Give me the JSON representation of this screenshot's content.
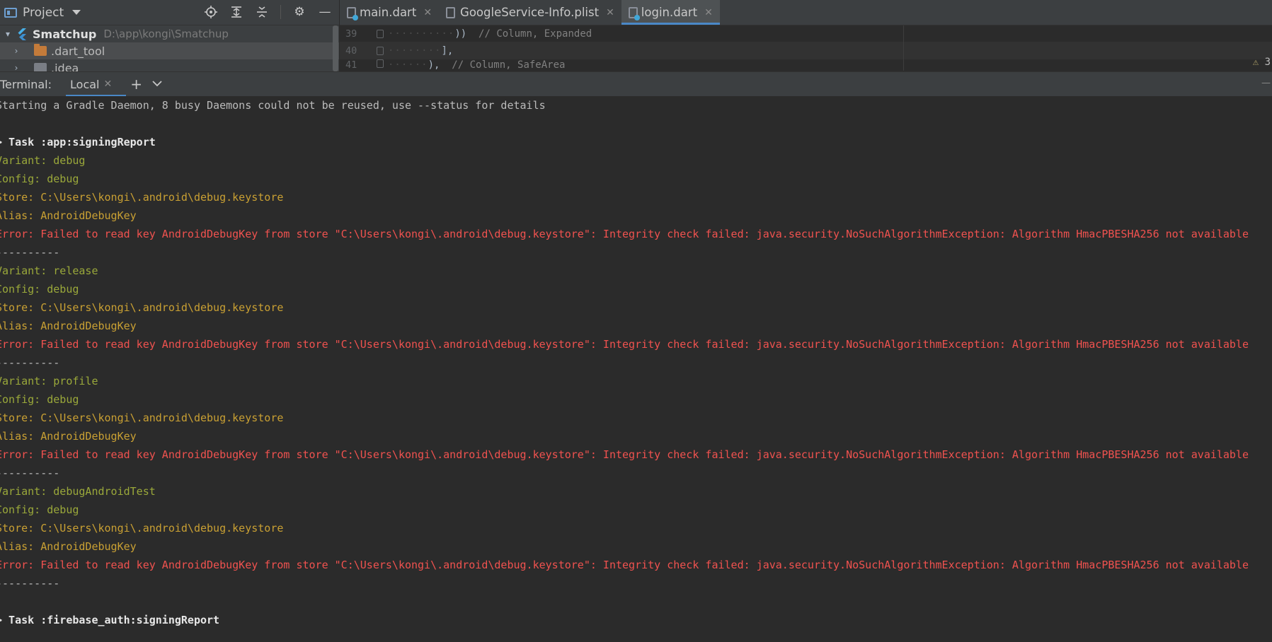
{
  "project_pane": {
    "title": "Project",
    "root": {
      "name": "Smatchup",
      "path": "D:\\app\\kongi\\Smatchup"
    },
    "items": [
      {
        "label": ".dart_tool"
      },
      {
        "label": ".idea"
      }
    ]
  },
  "editor": {
    "tabs": [
      {
        "label": "main.dart"
      },
      {
        "label": "GoogleService-Info.plist"
      },
      {
        "label": "login.dart"
      }
    ],
    "lines": [
      {
        "num": "39",
        "code": "))",
        "comment": "// Column, Expanded"
      },
      {
        "num": "40",
        "code": "],",
        "comment": ""
      },
      {
        "num": "41",
        "code": "),",
        "comment": "// Column, SafeArea"
      }
    ],
    "warnings": "3"
  },
  "terminal": {
    "label": "Terminal:",
    "tab": "Local",
    "lines": [
      {
        "text": "Starting a Gradle Daemon, 8 busy Daemons could not be reused, use --status for details",
        "style": "white"
      },
      {
        "text": "",
        "style": "white"
      },
      {
        "text": "> Task :app:signingReport",
        "style": "bold"
      },
      {
        "text": "Variant: debug",
        "style": "green"
      },
      {
        "text": "Config: debug",
        "style": "green"
      },
      {
        "text": "Store: C:\\Users\\kongi\\.android\\debug.keystore",
        "style": "yellow"
      },
      {
        "text": "Alias: AndroidDebugKey",
        "style": "yellow"
      },
      {
        "text": "Error: Failed to read key AndroidDebugKey from store \"C:\\Users\\kongi\\.android\\debug.keystore\": Integrity check failed: java.security.NoSuchAlgorithmException: Algorithm HmacPBESHA256 not available",
        "style": "red"
      },
      {
        "text": "----------",
        "style": "white"
      },
      {
        "text": "Variant: release",
        "style": "green"
      },
      {
        "text": "Config: debug",
        "style": "green"
      },
      {
        "text": "Store: C:\\Users\\kongi\\.android\\debug.keystore",
        "style": "yellow"
      },
      {
        "text": "Alias: AndroidDebugKey",
        "style": "yellow"
      },
      {
        "text": "Error: Failed to read key AndroidDebugKey from store \"C:\\Users\\kongi\\.android\\debug.keystore\": Integrity check failed: java.security.NoSuchAlgorithmException: Algorithm HmacPBESHA256 not available",
        "style": "red"
      },
      {
        "text": "----------",
        "style": "white"
      },
      {
        "text": "Variant: profile",
        "style": "green"
      },
      {
        "text": "Config: debug",
        "style": "green"
      },
      {
        "text": "Store: C:\\Users\\kongi\\.android\\debug.keystore",
        "style": "yellow"
      },
      {
        "text": "Alias: AndroidDebugKey",
        "style": "yellow"
      },
      {
        "text": "Error: Failed to read key AndroidDebugKey from store \"C:\\Users\\kongi\\.android\\debug.keystore\": Integrity check failed: java.security.NoSuchAlgorithmException: Algorithm HmacPBESHA256 not available",
        "style": "red"
      },
      {
        "text": "----------",
        "style": "white"
      },
      {
        "text": "Variant: debugAndroidTest",
        "style": "green"
      },
      {
        "text": "Config: debug",
        "style": "green"
      },
      {
        "text": "Store: C:\\Users\\kongi\\.android\\debug.keystore",
        "style": "yellow"
      },
      {
        "text": "Alias: AndroidDebugKey",
        "style": "yellow"
      },
      {
        "text": "Error: Failed to read key AndroidDebugKey from store \"C:\\Users\\kongi\\.android\\debug.keystore\": Integrity check failed: java.security.NoSuchAlgorithmException: Algorithm HmacPBESHA256 not available",
        "style": "red"
      },
      {
        "text": "----------",
        "style": "white"
      },
      {
        "text": "",
        "style": "white"
      },
      {
        "text": "> Task :firebase_auth:signingReport",
        "style": "bold"
      }
    ]
  },
  "colors": {
    "background": "#2b2b2b",
    "panel": "#3c3f41",
    "accent": "#4a88c7",
    "green": "#9aa83a",
    "yellow": "#c9a033",
    "red": "#f0524f"
  }
}
